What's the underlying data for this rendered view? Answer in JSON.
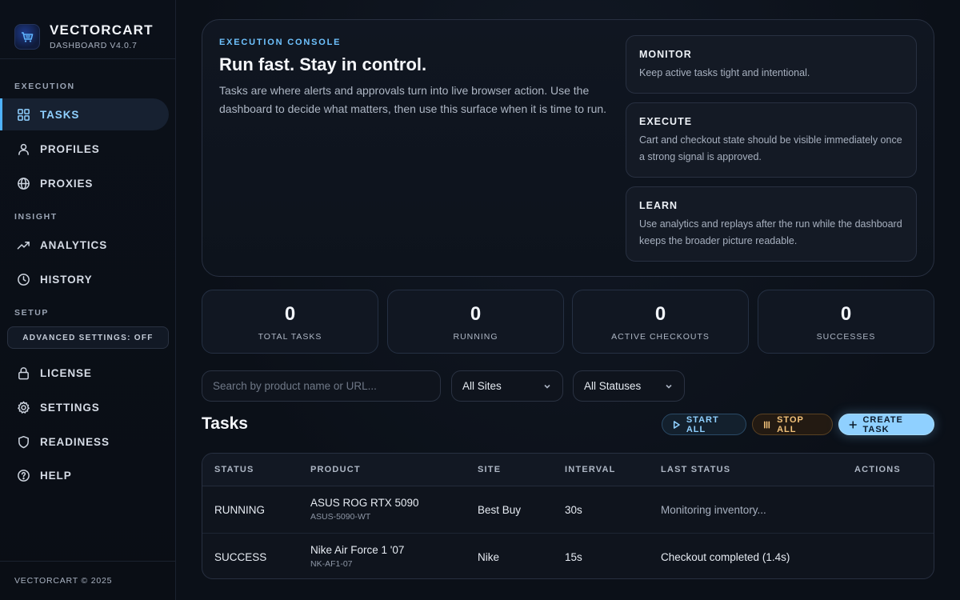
{
  "brand": {
    "name": "VECTORCART",
    "version": "DASHBOARD V4.0.7",
    "logo_icon": "cart-icon"
  },
  "sidebar": {
    "sections": {
      "execution": "EXECUTION",
      "insight": "INSIGHT",
      "setup": "SETUP"
    },
    "items": {
      "tasks": {
        "label": "TASKS",
        "icon": "grid-icon",
        "active": true
      },
      "profiles": {
        "label": "PROFILES",
        "icon": "user-icon"
      },
      "proxies": {
        "label": "PROXIES",
        "icon": "globe-icon"
      },
      "analytics": {
        "label": "ANALYTICS",
        "icon": "trend-icon"
      },
      "history": {
        "label": "HISTORY",
        "icon": "clock-icon"
      },
      "license": {
        "label": "LICENSE",
        "icon": "lock-icon"
      },
      "settings": {
        "label": "SETTINGS",
        "icon": "gear-icon"
      },
      "readiness": {
        "label": "READINESS",
        "icon": "shield-icon"
      },
      "help": {
        "label": "HELP",
        "icon": "help-icon"
      }
    },
    "advanced_settings": "ADVANCED SETTINGS: OFF",
    "copyright": "VECTORCART © 2025"
  },
  "hero": {
    "eyebrow": "EXECUTION CONSOLE",
    "title": "Run fast. Stay in control.",
    "description": "Tasks are where alerts and approvals turn into live browser action. Use the dashboard to decide what matters, then use this surface when it is time to run.",
    "cards": {
      "monitor": {
        "title": "MONITOR",
        "description": "Keep active tasks tight and intentional."
      },
      "execute": {
        "title": "EXECUTE",
        "description": "Cart and checkout state should be visible immediately once a strong signal is approved."
      },
      "learn": {
        "title": "LEARN",
        "description": "Use analytics and replays after the run while the dashboard keeps the broader picture readable."
      }
    }
  },
  "stats": {
    "total_tasks": {
      "value": "0",
      "label": "TOTAL TASKS"
    },
    "running": {
      "value": "0",
      "label": "RUNNING"
    },
    "active_checkouts": {
      "value": "0",
      "label": "ACTIVE CHECKOUTS"
    },
    "successes": {
      "value": "0",
      "label": "SUCCESSES"
    }
  },
  "filters": {
    "search_placeholder": "Search by product name or URL...",
    "search_value": "",
    "sites_selected": "All Sites",
    "statuses_selected": "All Statuses"
  },
  "tasks": {
    "title": "Tasks",
    "start_all": "START ALL",
    "stop_all": "STOP ALL",
    "create_task": "CREATE TASK",
    "columns": {
      "status": "STATUS",
      "product": "PRODUCT",
      "site": "SITE",
      "interval": "INTERVAL",
      "last_status": "LAST STATUS",
      "actions": "ACTIONS"
    },
    "rows": [
      {
        "status": "RUNNING",
        "product": "ASUS ROG RTX 5090",
        "sku": "ASUS-5090-WT",
        "site": "Best Buy",
        "interval": "30s",
        "last_status": "Monitoring inventory..."
      },
      {
        "status": "SUCCESS",
        "product": "Nike Air Force 1 '07",
        "sku": "NK-AF1-07",
        "site": "Nike",
        "interval": "15s",
        "last_status": "Checkout completed (1.4s)"
      }
    ]
  },
  "colors": {
    "accent": "#8fd0ff",
    "warning": "#f2c27a",
    "background": "#0a0f17"
  }
}
